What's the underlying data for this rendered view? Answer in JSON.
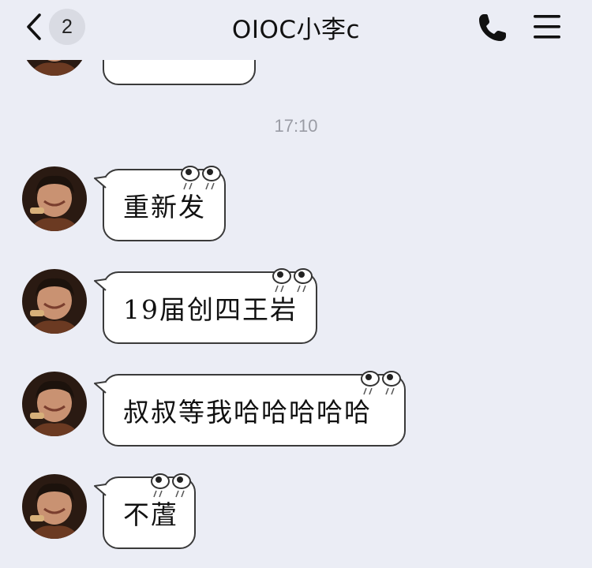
{
  "header": {
    "title": "OIOC小李c",
    "unread_count": "2",
    "back_icon": "chevron-left-icon",
    "call_icon": "phone-icon",
    "menu_icon": "menu-icon"
  },
  "timestamp": "17:10",
  "messages": [
    {
      "text": "重新发"
    },
    {
      "text": "19届创四王岩"
    },
    {
      "text": "叔叔等我哈哈哈哈哈"
    },
    {
      "text": "不蔖"
    }
  ],
  "colors": {
    "background": "#ebedf5",
    "bubble": "#ffffff",
    "bubble_border": "#3a3a3a",
    "timestamp": "#9a9ca5"
  }
}
